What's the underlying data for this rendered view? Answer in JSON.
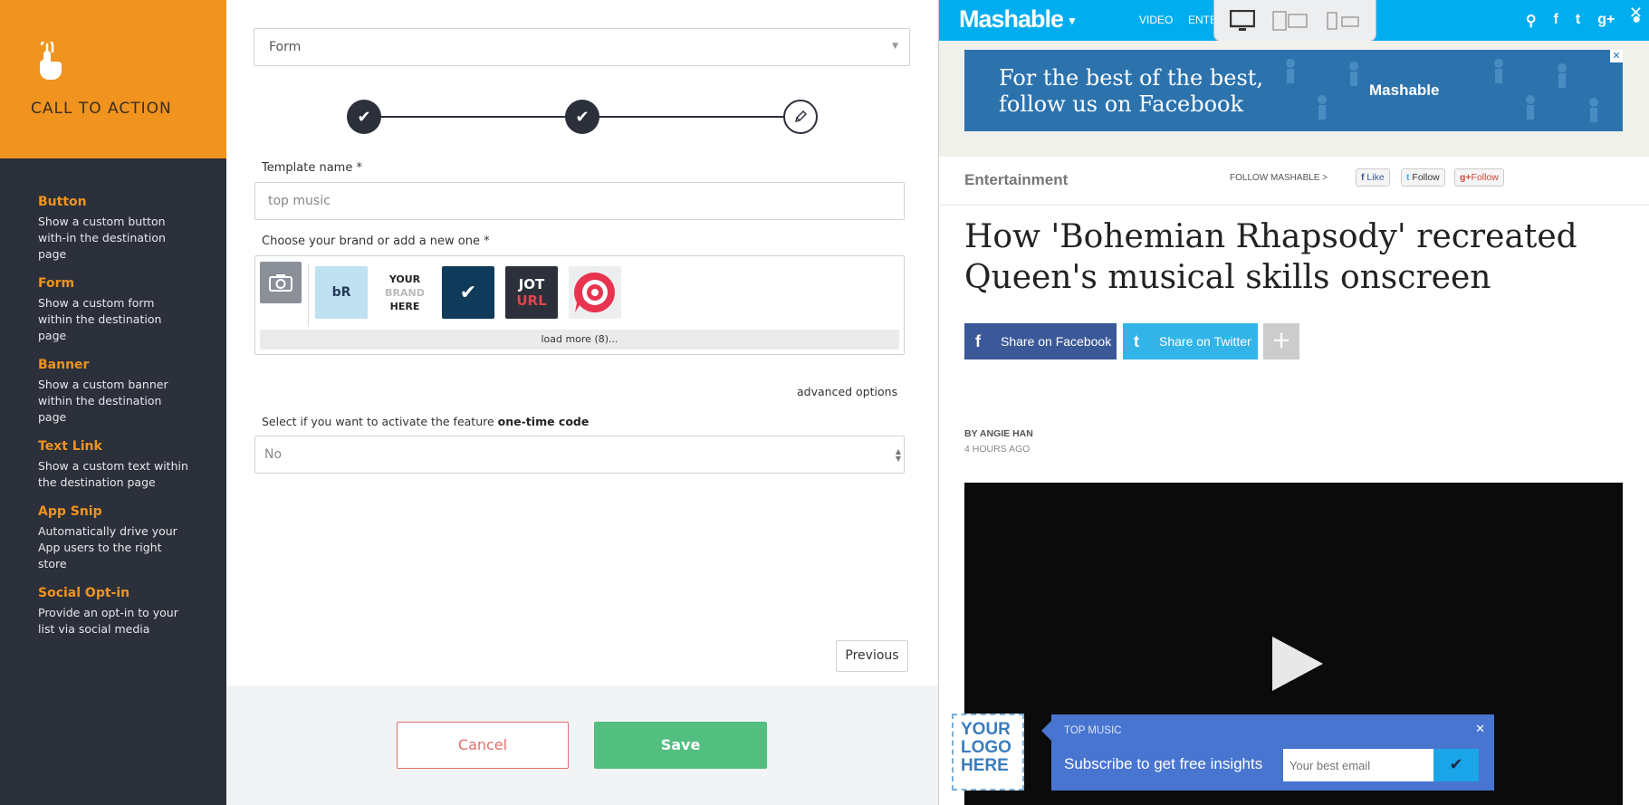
{
  "sidebar": {
    "title": "CALL TO ACTION",
    "items": [
      {
        "name": "Button",
        "desc": "Show a custom button with-in the destination page"
      },
      {
        "name": "Form",
        "desc": "Show a custom form within the destination page"
      },
      {
        "name": "Banner",
        "desc": "Show a custom banner within the destination page"
      },
      {
        "name": "Text Link",
        "desc": "Show a custom text within the destination page"
      },
      {
        "name": "App Snip",
        "desc": "Automatically drive your App users to the right store"
      },
      {
        "name": "Social Opt-in",
        "desc": "Provide an opt-in to your list via social media"
      }
    ]
  },
  "form": {
    "type_select": "Form",
    "template_label": "Template name *",
    "template_value": "top music",
    "brand_label": "Choose your brand or add a new one *",
    "brands": {
      "logo1": "bR",
      "logo2_l1": "YOUR",
      "logo2_l2": "BRAND",
      "logo2_l3": "HERE",
      "logo4_l1": "JOT",
      "logo4_l2": "URL"
    },
    "load_more": "load more (8)...",
    "advanced": "advanced options",
    "otc_prefix": "Select if you want to activate the feature ",
    "otc_bold": "one-time code",
    "otc_value": "No",
    "previous": "Previous",
    "cancel": "Cancel",
    "save": "Save"
  },
  "preview": {
    "brand": "Mashable",
    "nav": [
      "VIDEO",
      "ENTE"
    ],
    "ad_line1": "For the best of the best,",
    "ad_line2": "follow us on Facebook",
    "ad_logo": "Mashable",
    "category": "Entertainment",
    "follow_text": "FOLLOW MASHABLE >",
    "fb_like": "Like",
    "tw_follow": "Follow",
    "gp_follow": "Follow",
    "headline": "How 'Bohemian Rhapsody' recreated Queen's musical skills onscreen",
    "share_fb": "Share on Facebook",
    "share_tw": "Share on Twitter",
    "byline": "BY ANGIE HAN",
    "time": "4 HOURS AGO"
  },
  "cta": {
    "logo_l1": "YOUR",
    "logo_l2": "LOGO",
    "logo_l3": "HERE",
    "title": "TOP MUSIC",
    "subtitle": "Subscribe to get free insights",
    "email_placeholder": "Your best email"
  }
}
